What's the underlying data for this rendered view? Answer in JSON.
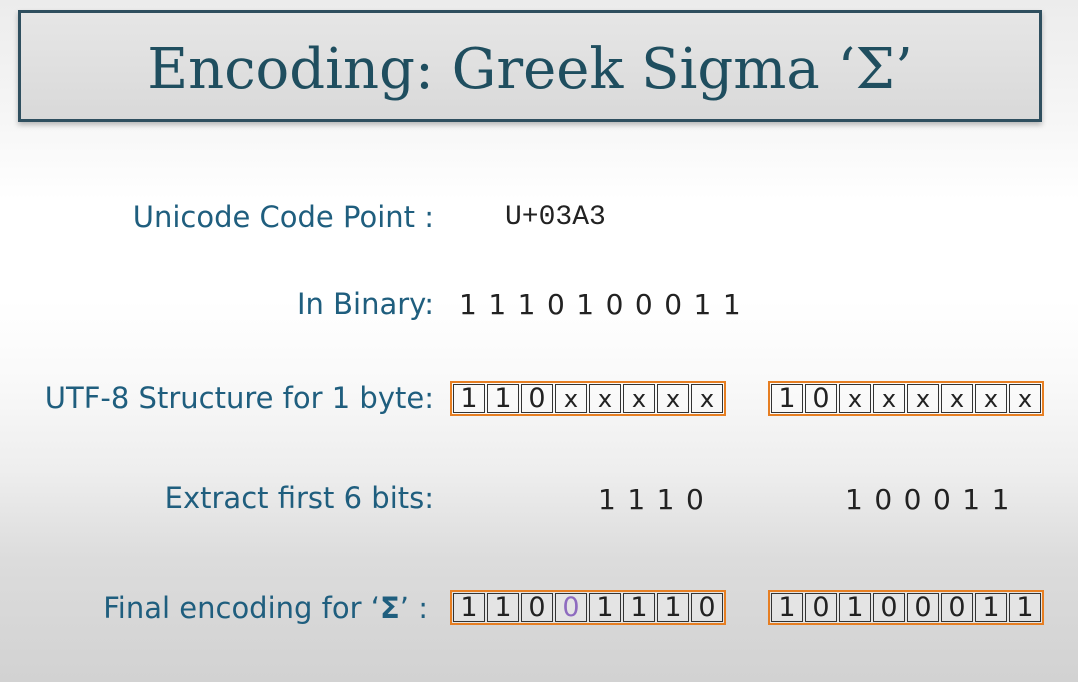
{
  "title": "Encoding: Greek Sigma ‘Σ’",
  "rows": {
    "code_point": {
      "label": "Unicode Code Point :",
      "value": "U+03A3"
    },
    "binary": {
      "label": "In Binary:",
      "value": "1 1 1 0 1 0 0 0 1 1"
    },
    "structure": {
      "label": "UTF-8 Structure for 1 byte:",
      "byte1": [
        "1",
        "1",
        "0",
        "x",
        "x",
        "x",
        "x",
        "x"
      ],
      "byte2": [
        "1",
        "0",
        "x",
        "x",
        "x",
        "x",
        "x",
        "x"
      ]
    },
    "extract": {
      "label": "Extract first 6 bits:",
      "bits1": "1 1 1 0",
      "bits2": "1 0 0 0 1 1"
    },
    "final": {
      "label_prefix": "Final encoding for ‘",
      "label_char": "Σ",
      "label_suffix": "’ :",
      "byte1": [
        "1",
        "1",
        "0",
        "0",
        "1",
        "1",
        "1",
        "0"
      ],
      "byte2": [
        "1",
        "0",
        "1",
        "0",
        "0",
        "0",
        "1",
        "1"
      ],
      "highlight_byte1_index": 3
    }
  },
  "colors": {
    "label": "#1f5e7e",
    "title": "#1f4e5f",
    "byte_border": "#e67e22",
    "highlight_bit": "#8e6bbf"
  }
}
